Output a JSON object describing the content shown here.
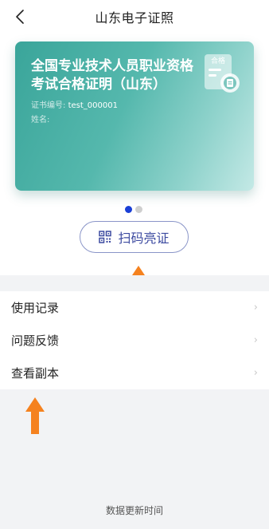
{
  "nav": {
    "title": "山东电子证照",
    "back_icon": "chevron-left-icon"
  },
  "card": {
    "title": "全国专业技术人员职业资格考试合格证明（山东）",
    "cert_no_label": "证书编号:",
    "cert_no_value": "test_000001",
    "name_label": "姓名:",
    "badge_text": "合格",
    "badge_icon": "certificate-badge-icon",
    "gradient": [
      "#3aa59a",
      "#c4e9e6"
    ]
  },
  "pager": {
    "count": 2,
    "active_index": 0,
    "active_color": "#1a3fd6"
  },
  "scan_button": {
    "label": "扫码亮证",
    "icon": "qr-code-icon",
    "color": "#3c4aa0"
  },
  "menu": {
    "items": [
      {
        "label": "使用记录"
      },
      {
        "label": "问题反馈"
      },
      {
        "label": "查看副本"
      }
    ]
  },
  "footer": {
    "text": "数据更新时间"
  },
  "annotation": {
    "arrow_color": "#f5821f"
  }
}
